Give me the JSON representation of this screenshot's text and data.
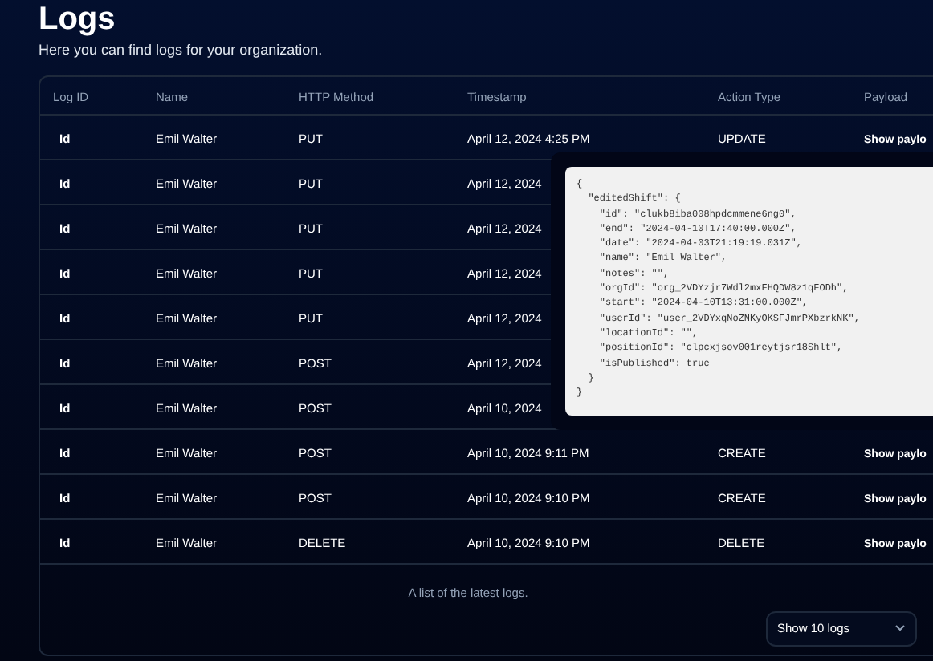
{
  "header": {
    "title": "Logs",
    "subtitle": "Here you can find logs for your organization."
  },
  "table": {
    "columns": [
      "Log ID",
      "Name",
      "HTTP Method",
      "Timestamp",
      "Action Type",
      "Payload"
    ],
    "rows": [
      {
        "log_id": "Id",
        "name": "Emil Walter",
        "method": "PUT",
        "timestamp": "April 12, 2024 4:25 PM",
        "action": "UPDATE",
        "payload_link": "Show paylo"
      },
      {
        "log_id": "Id",
        "name": "Emil Walter",
        "method": "PUT",
        "timestamp": "April 12, 2024"
      },
      {
        "log_id": "Id",
        "name": "Emil Walter",
        "method": "PUT",
        "timestamp": "April 12, 2024"
      },
      {
        "log_id": "Id",
        "name": "Emil Walter",
        "method": "PUT",
        "timestamp": "April 12, 2024"
      },
      {
        "log_id": "Id",
        "name": "Emil Walter",
        "method": "PUT",
        "timestamp": "April 12, 2024"
      },
      {
        "log_id": "Id",
        "name": "Emil Walter",
        "method": "POST",
        "timestamp": "April 12, 2024"
      },
      {
        "log_id": "Id",
        "name": "Emil Walter",
        "method": "POST",
        "timestamp": "April 10, 2024"
      },
      {
        "log_id": "Id",
        "name": "Emil Walter",
        "method": "POST",
        "timestamp": "April 10, 2024 9:11 PM",
        "action": "CREATE",
        "payload_link": "Show paylo"
      },
      {
        "log_id": "Id",
        "name": "Emil Walter",
        "method": "POST",
        "timestamp": "April 10, 2024 9:10 PM",
        "action": "CREATE",
        "payload_link": "Show paylo"
      },
      {
        "log_id": "Id",
        "name": "Emil Walter",
        "method": "DELETE",
        "timestamp": "April 10, 2024 9:10 PM",
        "action": "DELETE",
        "payload_link": "Show paylo"
      }
    ],
    "caption": "A list of the latest logs."
  },
  "payload_popover": {
    "code": "{\n  \"editedShift\": {\n    \"id\": \"clukb8iba008hpdcmmene6ng0\",\n    \"end\": \"2024-04-10T17:40:00.000Z\",\n    \"date\": \"2024-04-03T21:19:19.031Z\",\n    \"name\": \"Emil Walter\",\n    \"notes\": \"\",\n    \"orgId\": \"org_2VDYzjr7Wdl2mxFHQDW8z1qFODh\",\n    \"start\": \"2024-04-10T13:31:00.000Z\",\n    \"userId\": \"user_2VDYxqNoZNKyOKSFJmrPXbzrkNK\",\n    \"locationId\": \"\",\n    \"positionId\": \"clpcxjsov001reytjsr18Shlt\",\n    \"isPublished\": true\n  }\n}"
  },
  "pagination": {
    "page_size": "Show 10 logs"
  }
}
